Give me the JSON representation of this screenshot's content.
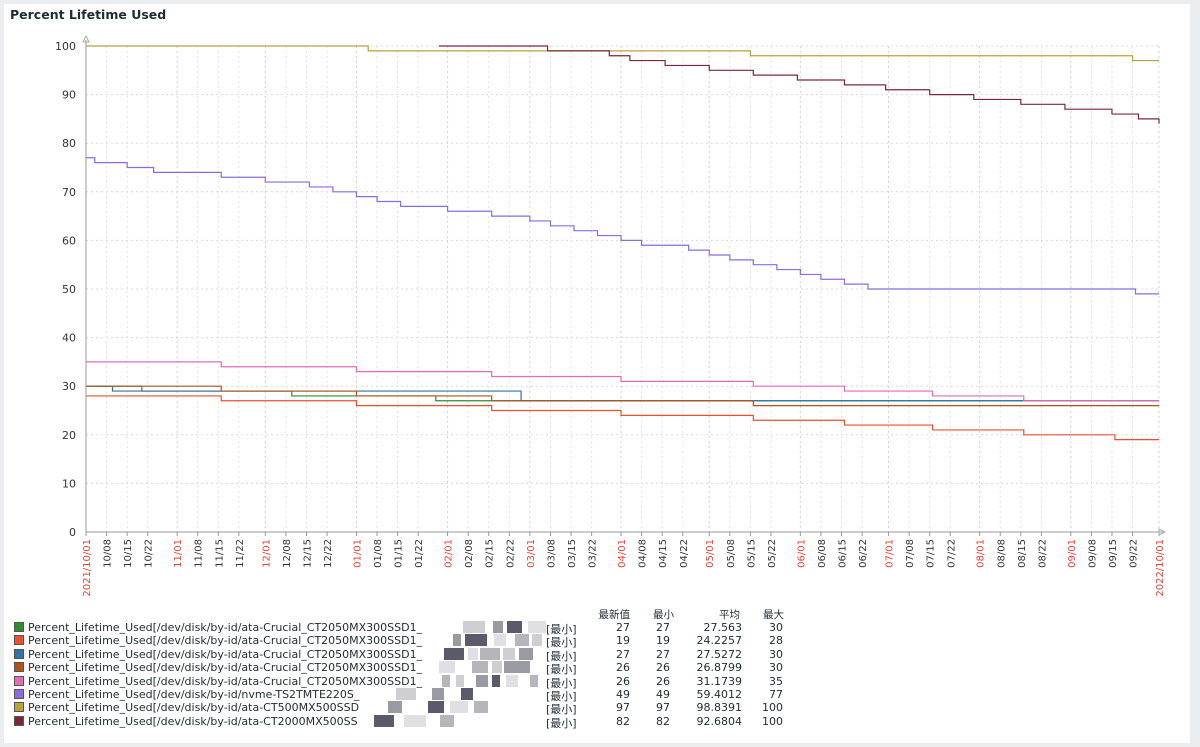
{
  "title": "Percent Lifetime Used",
  "legend_headers": [
    "最新值",
    "最小",
    "平均",
    "最大"
  ],
  "chart_data": {
    "type": "line",
    "x_axis": {
      "start": "2021/10/01",
      "end": "2022/10/01",
      "tick_labels": [
        {
          "date": "2021-10-01",
          "label": "2021/10/01",
          "color": "#e0463a"
        },
        {
          "date": "2021-10-08",
          "label": "10/08",
          "color": "#333333"
        },
        {
          "date": "2021-10-15",
          "label": "10/15",
          "color": "#333333"
        },
        {
          "date": "2021-10-22",
          "label": "10/22",
          "color": "#333333"
        },
        {
          "date": "2021-11-01",
          "label": "11/01",
          "color": "#e0463a"
        },
        {
          "date": "2021-11-08",
          "label": "11/08",
          "color": "#333333"
        },
        {
          "date": "2021-11-15",
          "label": "11/15",
          "color": "#333333"
        },
        {
          "date": "2021-11-22",
          "label": "11/22",
          "color": "#333333"
        },
        {
          "date": "2021-12-01",
          "label": "12/01",
          "color": "#e0463a"
        },
        {
          "date": "2021-12-08",
          "label": "12/08",
          "color": "#333333"
        },
        {
          "date": "2021-12-15",
          "label": "12/15",
          "color": "#333333"
        },
        {
          "date": "2021-12-22",
          "label": "12/22",
          "color": "#333333"
        },
        {
          "date": "2022-01-01",
          "label": "01/01",
          "color": "#e0463a"
        },
        {
          "date": "2022-01-08",
          "label": "01/08",
          "color": "#333333"
        },
        {
          "date": "2022-01-15",
          "label": "01/15",
          "color": "#333333"
        },
        {
          "date": "2022-01-22",
          "label": "01/22",
          "color": "#333333"
        },
        {
          "date": "2022-02-01",
          "label": "02/01",
          "color": "#e0463a"
        },
        {
          "date": "2022-02-08",
          "label": "02/08",
          "color": "#333333"
        },
        {
          "date": "2022-02-15",
          "label": "02/15",
          "color": "#333333"
        },
        {
          "date": "2022-02-22",
          "label": "02/22",
          "color": "#333333"
        },
        {
          "date": "2022-03-01",
          "label": "03/01",
          "color": "#e0463a"
        },
        {
          "date": "2022-03-08",
          "label": "03/08",
          "color": "#333333"
        },
        {
          "date": "2022-03-15",
          "label": "03/15",
          "color": "#333333"
        },
        {
          "date": "2022-03-22",
          "label": "03/22",
          "color": "#333333"
        },
        {
          "date": "2022-04-01",
          "label": "04/01",
          "color": "#e0463a"
        },
        {
          "date": "2022-04-08",
          "label": "04/08",
          "color": "#333333"
        },
        {
          "date": "2022-04-15",
          "label": "04/15",
          "color": "#333333"
        },
        {
          "date": "2022-04-22",
          "label": "04/22",
          "color": "#333333"
        },
        {
          "date": "2022-05-01",
          "label": "05/01",
          "color": "#e0463a"
        },
        {
          "date": "2022-05-08",
          "label": "05/08",
          "color": "#333333"
        },
        {
          "date": "2022-05-15",
          "label": "05/15",
          "color": "#333333"
        },
        {
          "date": "2022-05-22",
          "label": "05/22",
          "color": "#333333"
        },
        {
          "date": "2022-06-01",
          "label": "06/01",
          "color": "#e0463a"
        },
        {
          "date": "2022-06-08",
          "label": "06/08",
          "color": "#333333"
        },
        {
          "date": "2022-06-15",
          "label": "06/15",
          "color": "#333333"
        },
        {
          "date": "2022-06-22",
          "label": "06/22",
          "color": "#333333"
        },
        {
          "date": "2022-07-01",
          "label": "07/01",
          "color": "#e0463a"
        },
        {
          "date": "2022-07-08",
          "label": "07/08",
          "color": "#333333"
        },
        {
          "date": "2022-07-15",
          "label": "07/15",
          "color": "#333333"
        },
        {
          "date": "2022-07-22",
          "label": "07/22",
          "color": "#333333"
        },
        {
          "date": "2022-08-01",
          "label": "08/01",
          "color": "#e0463a"
        },
        {
          "date": "2022-08-08",
          "label": "08/08",
          "color": "#333333"
        },
        {
          "date": "2022-08-15",
          "label": "08/15",
          "color": "#333333"
        },
        {
          "date": "2022-08-22",
          "label": "08/22",
          "color": "#333333"
        },
        {
          "date": "2022-09-01",
          "label": "09/01",
          "color": "#e0463a"
        },
        {
          "date": "2022-09-08",
          "label": "09/08",
          "color": "#333333"
        },
        {
          "date": "2022-09-15",
          "label": "09/15",
          "color": "#333333"
        },
        {
          "date": "2022-09-22",
          "label": "09/22",
          "color": "#333333"
        },
        {
          "date": "2022-10-01",
          "label": "2022/10/01",
          "color": "#e0463a"
        }
      ]
    },
    "y_axis": {
      "min": 0,
      "max": 100,
      "ticks": [
        0,
        10,
        20,
        30,
        40,
        50,
        60,
        70,
        80,
        90,
        100
      ]
    },
    "grid": true,
    "series": [
      {
        "name": "Percent_Lifetime_Used[/dev/disk/by-id/ata-Crucial_CT2050MX300SSD1_",
        "color": "#2f8f2f",
        "steps": [
          [
            "2021-10-01",
            30
          ],
          [
            "2021-10-10",
            30
          ],
          [
            "2021-10-20",
            29
          ],
          [
            "2021-12-01",
            29
          ],
          [
            "2021-12-10",
            28
          ],
          [
            "2022-01-18",
            28
          ],
          [
            "2022-01-28",
            27
          ],
          [
            "2022-10-01",
            27
          ]
        ],
        "last": "27",
        "min": "27",
        "avg": "27.563",
        "max": "30",
        "redactions": [
          {
            "x": 31,
            "w": 22
          },
          {
            "x": 61,
            "w": 10
          },
          {
            "x": 75,
            "w": 15
          },
          {
            "x": 96,
            "w": 18
          }
        ]
      },
      {
        "name": "Percent_Lifetime_Used[/dev/disk/by-id/ata-Crucial_CT2050MX300SSD1_",
        "color": "#e8512e",
        "steps": [
          [
            "2021-10-01",
            28
          ],
          [
            "2021-11-16",
            27
          ],
          [
            "2022-01-01",
            26
          ],
          [
            "2022-02-16",
            25
          ],
          [
            "2022-04-01",
            24
          ],
          [
            "2022-05-16",
            23
          ],
          [
            "2022-06-16",
            22
          ],
          [
            "2022-07-16",
            21
          ],
          [
            "2022-08-16",
            20
          ],
          [
            "2022-09-16",
            19
          ],
          [
            "2022-10-01",
            19
          ]
        ],
        "last": "19",
        "min": "19",
        "avg": "24.2257",
        "max": "28",
        "redactions": [
          {
            "x": 21,
            "w": 8
          },
          {
            "x": 33,
            "w": 22
          },
          {
            "x": 62,
            "w": 12
          },
          {
            "x": 83,
            "w": 14
          },
          {
            "x": 100,
            "w": 10
          }
        ]
      },
      {
        "name": "Percent_Lifetime_Used[/dev/disk/by-id/ata-Crucial_CT2050MX300SSD1_",
        "color": "#2f74a8",
        "steps": [
          [
            "2021-10-01",
            30
          ],
          [
            "2021-10-10",
            29
          ],
          [
            "2022-02-26",
            27
          ],
          [
            "2022-10-01",
            27
          ]
        ],
        "last": "27",
        "min": "27",
        "avg": "27.5272",
        "max": "30",
        "redactions": [
          {
            "x": 12,
            "w": 20
          },
          {
            "x": 36,
            "w": 10
          },
          {
            "x": 48,
            "w": 20
          },
          {
            "x": 71,
            "w": 12
          },
          {
            "x": 87,
            "w": 14
          }
        ]
      },
      {
        "name": "Percent_Lifetime_Used[/dev/disk/by-id/ata-Crucial_CT2050MX300SSD1_",
        "color": "#b0541e",
        "steps": [
          [
            "2021-10-01",
            30
          ],
          [
            "2021-11-16",
            29
          ],
          [
            "2022-01-01",
            28
          ],
          [
            "2022-02-16",
            27
          ],
          [
            "2022-05-16",
            26
          ],
          [
            "2022-10-01",
            26
          ]
        ],
        "last": "26",
        "min": "26",
        "avg": "26.8799",
        "max": "30",
        "redactions": [
          {
            "x": 7,
            "w": 16
          },
          {
            "x": 40,
            "w": 16
          },
          {
            "x": 60,
            "w": 10
          },
          {
            "x": 72,
            "w": 26
          }
        ]
      },
      {
        "name": "Percent_Lifetime_Used[/dev/disk/by-id/ata-Crucial_CT2050MX300SSD1_",
        "color": "#e46cb4",
        "steps": [
          [
            "2021-10-01",
            35
          ],
          [
            "2021-11-16",
            34
          ],
          [
            "2022-01-01",
            33
          ],
          [
            "2022-02-16",
            32
          ],
          [
            "2022-04-01",
            31
          ],
          [
            "2022-05-16",
            30
          ],
          [
            "2022-06-16",
            29
          ],
          [
            "2022-07-16",
            28
          ],
          [
            "2022-08-16",
            27
          ],
          [
            "2022-10-01",
            27
          ]
        ],
        "last": "26",
        "min": "26",
        "avg": "31.1739",
        "max": "35",
        "redactions": [
          {
            "x": 10,
            "w": 8
          },
          {
            "x": 24,
            "w": 8
          },
          {
            "x": 44,
            "w": 12
          },
          {
            "x": 60,
            "w": 8
          },
          {
            "x": 74,
            "w": 12
          },
          {
            "x": 98,
            "w": 8
          }
        ]
      },
      {
        "name": "Percent_Lifetime_Used[/dev/disk/by-id/nvme-TS2TMTE220S_",
        "color": "#8a6be0",
        "steps": [
          [
            "2021-10-01",
            77
          ],
          [
            "2021-10-04",
            76
          ],
          [
            "2021-10-15",
            75
          ],
          [
            "2021-10-24",
            74
          ],
          [
            "2021-11-16",
            73
          ],
          [
            "2021-12-01",
            72
          ],
          [
            "2021-12-16",
            71
          ],
          [
            "2021-12-24",
            70
          ],
          [
            "2022-01-01",
            69
          ],
          [
            "2022-01-08",
            68
          ],
          [
            "2022-01-16",
            67
          ],
          [
            "2022-02-01",
            66
          ],
          [
            "2022-02-16",
            65
          ],
          [
            "2022-03-01",
            64
          ],
          [
            "2022-03-08",
            63
          ],
          [
            "2022-03-16",
            62
          ],
          [
            "2022-03-24",
            61
          ],
          [
            "2022-04-01",
            60
          ],
          [
            "2022-04-08",
            59
          ],
          [
            "2022-04-24",
            58
          ],
          [
            "2022-05-01",
            57
          ],
          [
            "2022-05-08",
            56
          ],
          [
            "2022-05-16",
            55
          ],
          [
            "2022-05-24",
            54
          ],
          [
            "2022-06-01",
            53
          ],
          [
            "2022-06-08",
            52
          ],
          [
            "2022-06-16",
            51
          ],
          [
            "2022-06-24",
            50
          ],
          [
            "2022-09-23",
            49
          ],
          [
            "2022-10-01",
            49
          ]
        ],
        "last": "49",
        "min": "49",
        "avg": "59.4012",
        "max": "77",
        "redactions": [
          {
            "x": 30,
            "w": 20
          },
          {
            "x": 66,
            "w": 12
          },
          {
            "x": 95,
            "w": 12
          }
        ]
      },
      {
        "name": "Percent_Lifetime_Used[/dev/disk/by-id/ata-CT500MX500SSD",
        "color": "#b8a23a",
        "steps": [
          [
            "2021-10-01",
            100
          ],
          [
            "2022-01-05",
            99
          ],
          [
            "2022-05-15",
            98
          ],
          [
            "2022-09-22",
            97
          ],
          [
            "2022-10-01",
            97
          ]
        ],
        "last": "97",
        "min": "97",
        "avg": "98.8391",
        "max": "100",
        "redactions": [
          {
            "x": 22,
            "w": 14
          },
          {
            "x": 62,
            "w": 16
          },
          {
            "x": 84,
            "w": 18
          },
          {
            "x": 108,
            "w": 14
          }
        ]
      },
      {
        "name": "Percent_Lifetime_Used[/dev/disk/by-id/ata-CT2000MX500SS",
        "color": "#7a2838",
        "steps": [
          [
            "2022-01-29",
            100
          ],
          [
            "2022-03-07",
            99
          ],
          [
            "2022-03-28",
            98
          ],
          [
            "2022-04-04",
            97
          ],
          [
            "2022-04-16",
            96
          ],
          [
            "2022-05-01",
            95
          ],
          [
            "2022-05-16",
            94
          ],
          [
            "2022-05-31",
            93
          ],
          [
            "2022-06-16",
            92
          ],
          [
            "2022-06-30",
            91
          ],
          [
            "2022-07-15",
            90
          ],
          [
            "2022-07-30",
            89
          ],
          [
            "2022-08-15",
            88
          ],
          [
            "2022-08-30",
            87
          ],
          [
            "2022-09-15",
            86
          ],
          [
            "2022-09-24",
            85
          ],
          [
            "2022-10-01",
            84
          ]
        ],
        "last": "82",
        "min": "82",
        "avg": "92.6804",
        "max": "100",
        "redactions": [
          {
            "x": 8,
            "w": 20
          },
          {
            "x": 38,
            "w": 22
          },
          {
            "x": 74,
            "w": 14
          }
        ]
      }
    ]
  },
  "legend_func": "[最小]"
}
